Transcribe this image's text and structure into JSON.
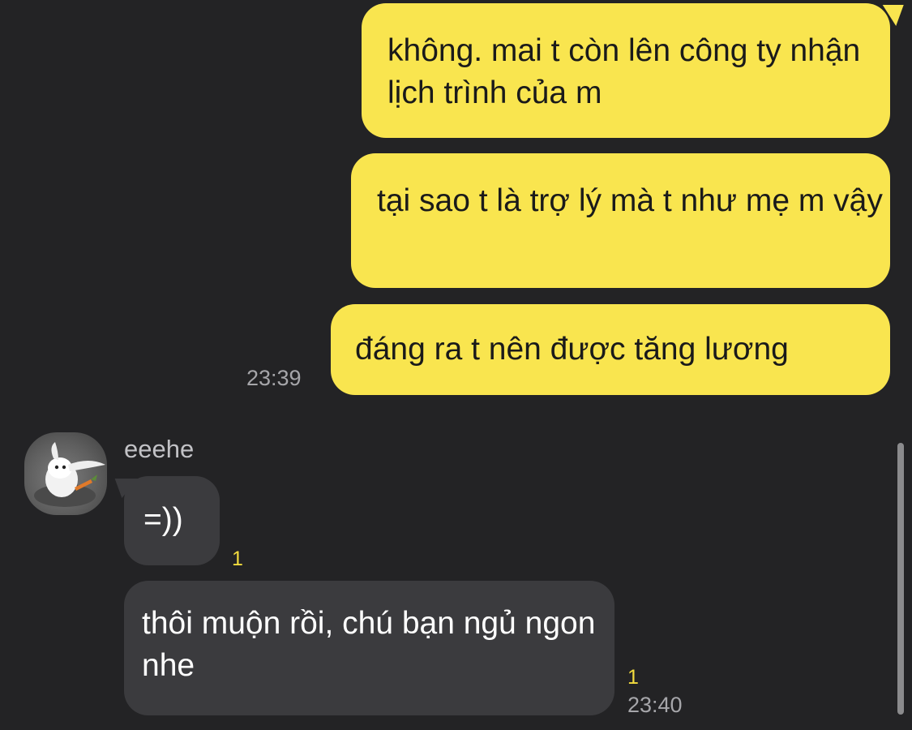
{
  "messages_sent": [
    {
      "text": "không. mai t còn lên công ty nhận lịch trình của m"
    },
    {
      "text": "tại sao t là trợ lý mà t như mẹ m vậy"
    },
    {
      "text": "đáng ra t nên được tăng lương",
      "time": "23:39"
    }
  ],
  "contact": {
    "name": "eeehe"
  },
  "messages_received": [
    {
      "text": "=))",
      "unread": "1"
    },
    {
      "text": "thôi muộn rồi, chú bạn ngủ ngon nhe",
      "unread": "1",
      "time": "23:40"
    }
  ],
  "colors": {
    "background": "#232325",
    "sent_bubble": "#f9e54f",
    "received_bubble": "#3b3b3e",
    "unread_count": "#f3dc3e"
  },
  "icons": {
    "avatar": "snowball-bunny-avatar"
  }
}
